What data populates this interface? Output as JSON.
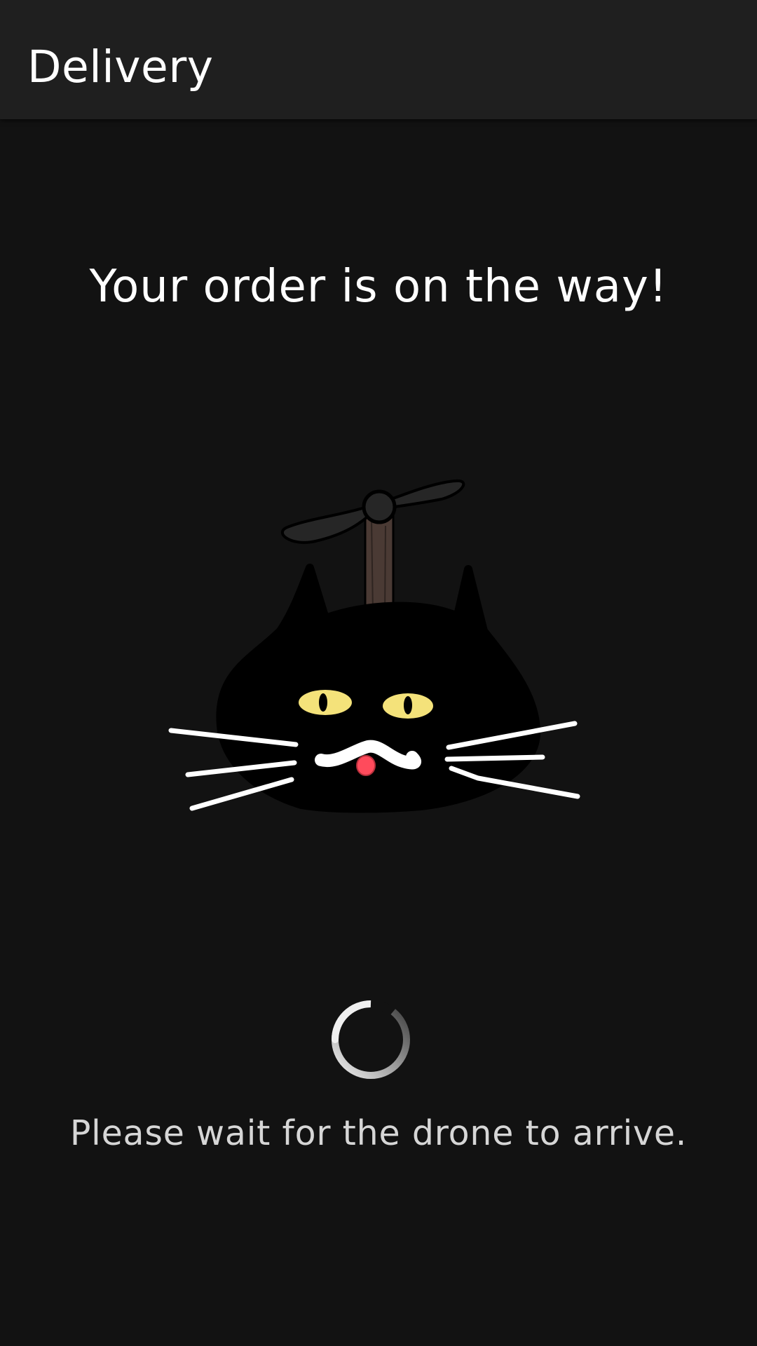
{
  "app_bar": {
    "title": "Delivery"
  },
  "main": {
    "headline": "Your order is on the way!",
    "illustration_icon": "cat-propeller-drone-icon",
    "spinner_icon": "loading-spinner-icon",
    "wait_message": "Please wait for the drone to arrive."
  },
  "colors": {
    "background": "#121212",
    "app_bar": "#1f1f1f",
    "text_primary": "#ffffff",
    "text_secondary": "#d6d6d6",
    "cat_eyes": "#f4e27a",
    "cat_tongue": "#ff4b5c",
    "propeller_pole": "#4a3a34"
  }
}
